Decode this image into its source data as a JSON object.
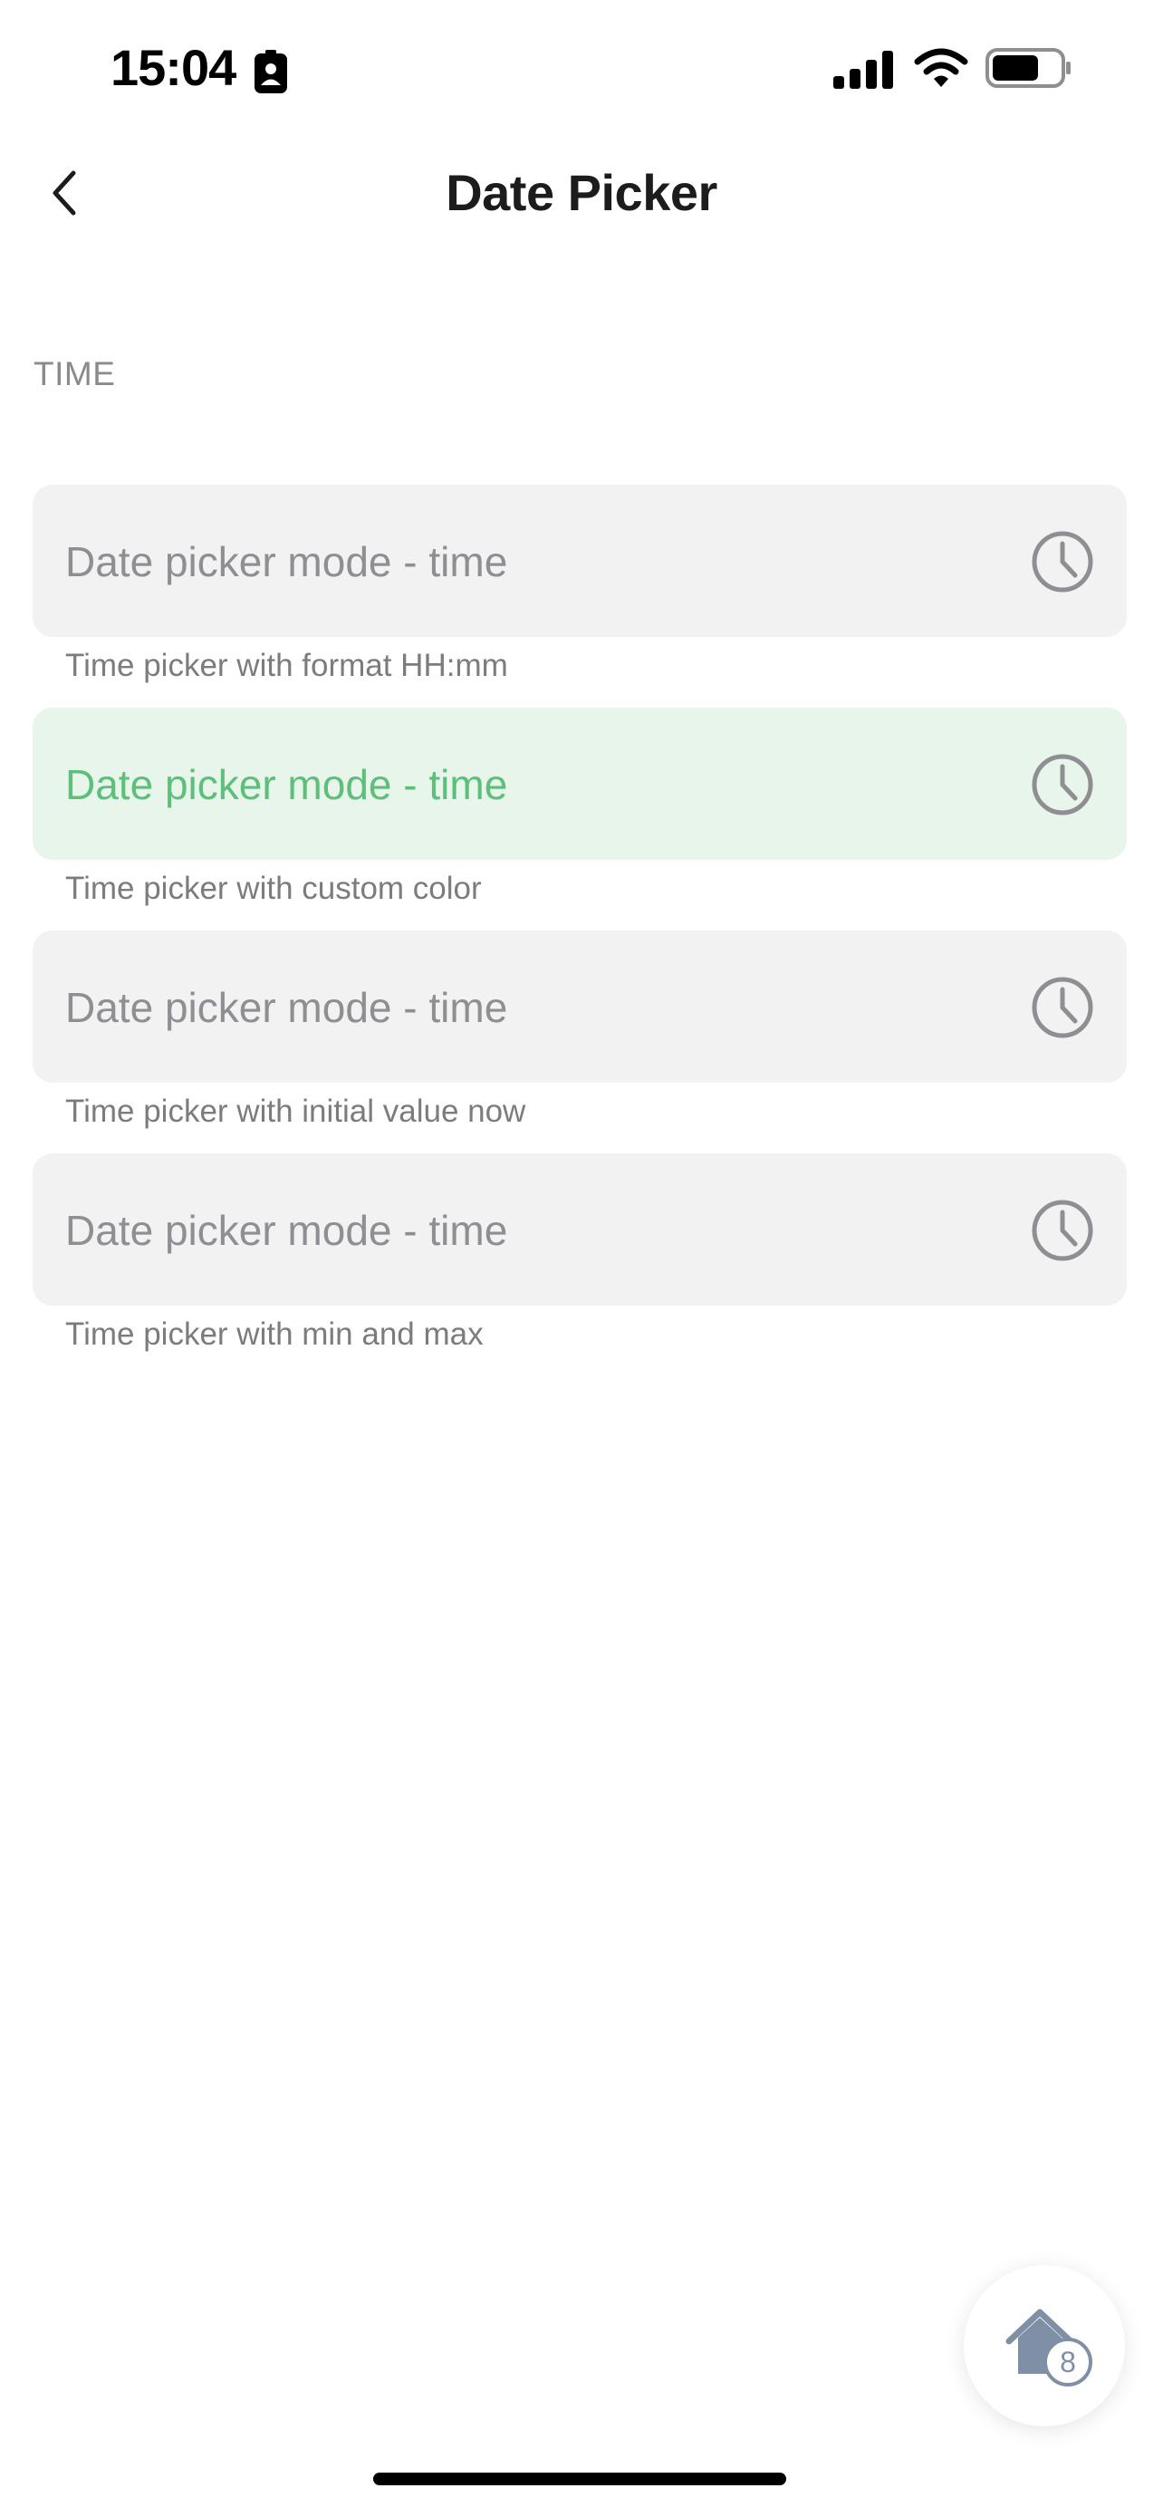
{
  "status_bar": {
    "time": "15:04",
    "icons": [
      "person-badge-icon",
      "signal-icon",
      "wifi-icon",
      "battery-icon"
    ]
  },
  "nav": {
    "title": "Date Picker",
    "back_icon": "chevron-left-icon"
  },
  "section": {
    "header": "TIME"
  },
  "fields": [
    {
      "placeholder": "Date picker mode - time",
      "caption": "Time picker with format HH:mm",
      "icon": "clock-icon"
    },
    {
      "placeholder": "Date picker mode - time",
      "caption": "Time picker with custom color",
      "icon": "clock-icon",
      "accent_color": "#5cbf7a"
    },
    {
      "placeholder": "Date picker mode - time",
      "caption": "Time picker with initial value now",
      "icon": "clock-icon"
    },
    {
      "placeholder": "Date picker mode - time",
      "caption": "Time picker with min and max",
      "icon": "clock-icon"
    }
  ],
  "fab": {
    "icon": "home-icon",
    "badge": "8"
  }
}
